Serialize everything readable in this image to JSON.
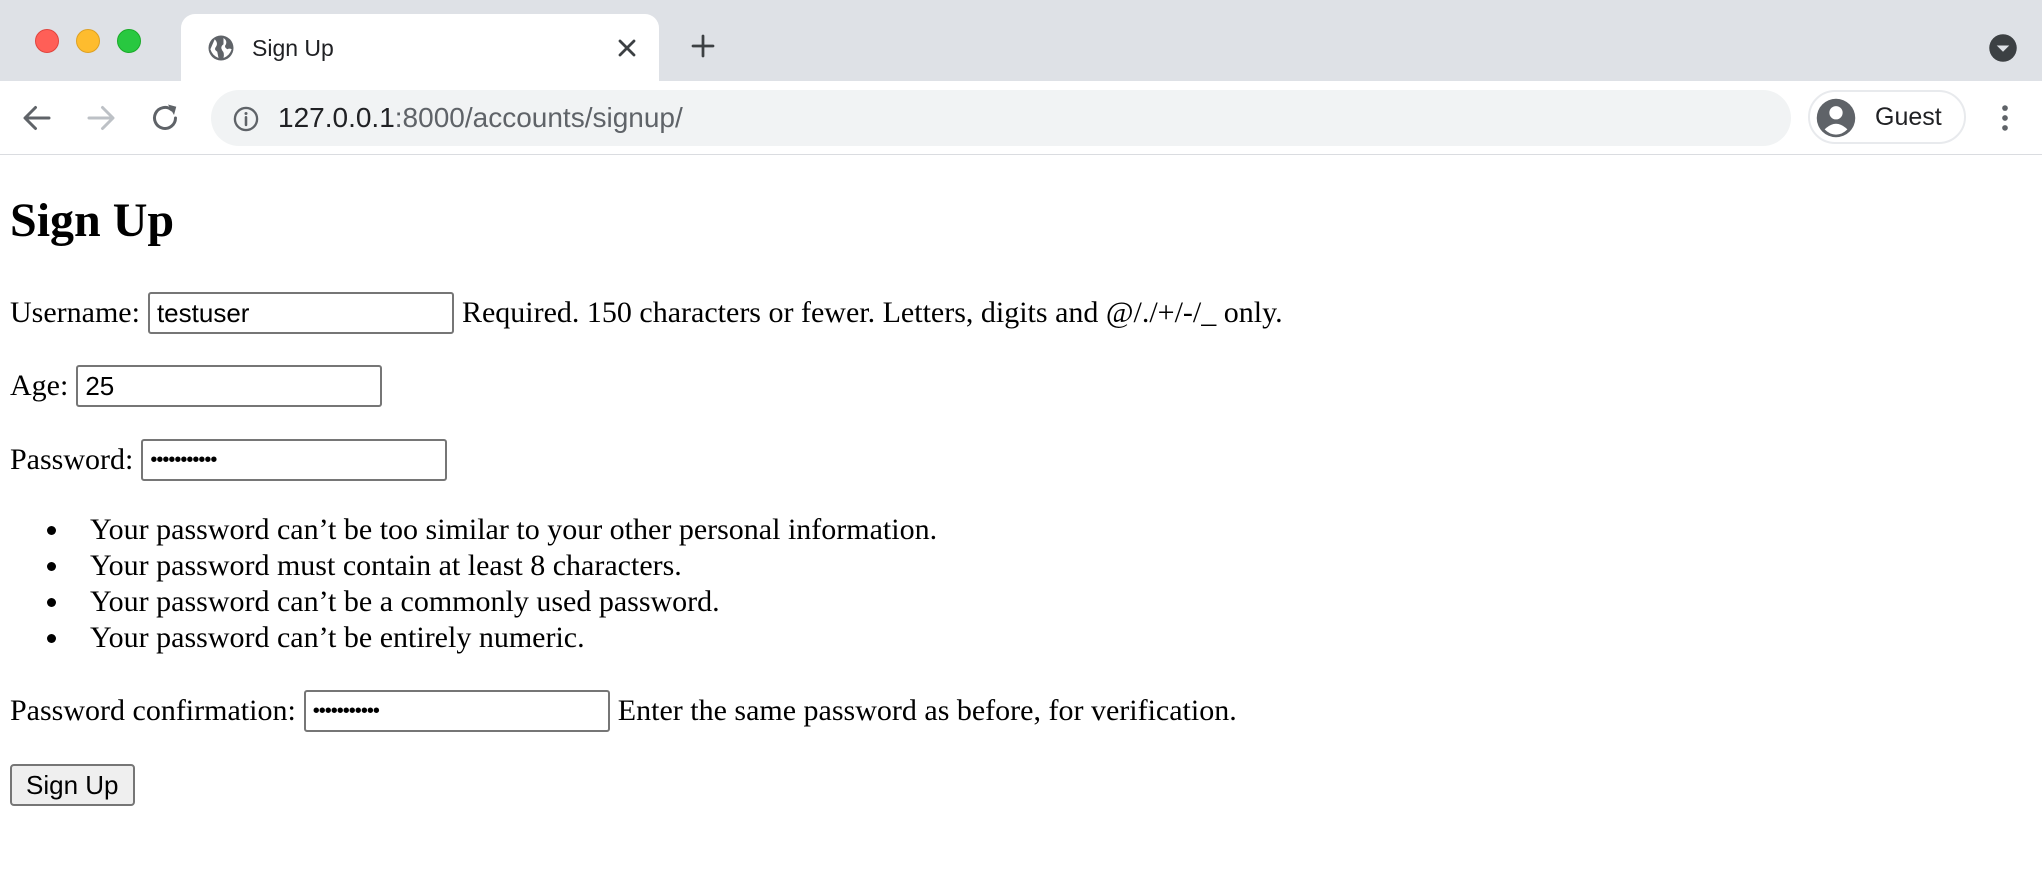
{
  "browser": {
    "tab_title": "Sign Up",
    "url_host": "127.0.0.1",
    "url_rest": ":8000/accounts/signup/",
    "profile_label": "Guest"
  },
  "page": {
    "heading": "Sign Up",
    "username": {
      "label": "Username:",
      "value": "testuser",
      "help": "Required. 150 characters or fewer. Letters, digits and @/./+/-/_ only."
    },
    "age": {
      "label": "Age:",
      "value": "25"
    },
    "password": {
      "label": "Password:",
      "value": "•••••••••••",
      "rules": [
        "Your password can’t be too similar to your other personal information.",
        "Your password must contain at least 8 characters.",
        "Your password can’t be a commonly used password.",
        "Your password can’t be entirely numeric."
      ]
    },
    "password_confirmation": {
      "label": "Password confirmation:",
      "value": "•••••••••••",
      "help": "Enter the same password as before, for verification."
    },
    "submit_label": "Sign Up"
  },
  "colors": {
    "tabbar_bg": "#dee1e6",
    "omnibox_bg": "#f1f3f4",
    "traffic_red": "#ff5f57",
    "traffic_yellow": "#febc2e",
    "traffic_green": "#28c840"
  }
}
